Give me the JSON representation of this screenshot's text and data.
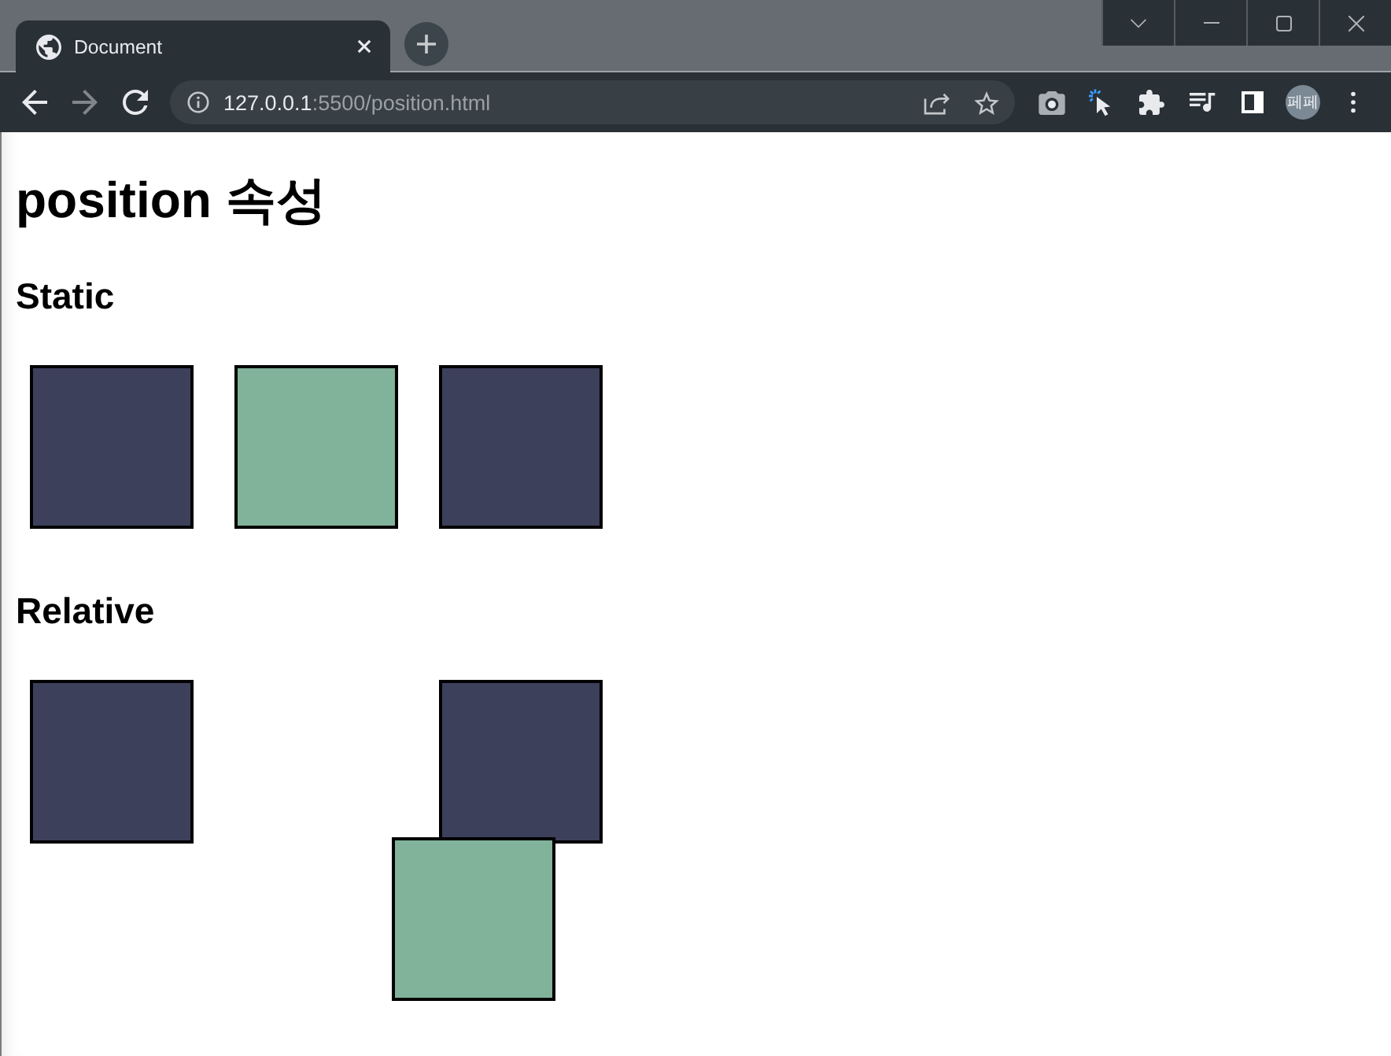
{
  "tabs": [
    {
      "title": "Document",
      "selected": true
    }
  ],
  "nav_buttons": [
    {
      "kind": "back",
      "disabled": false
    },
    {
      "kind": "forward",
      "disabled": true
    },
    {
      "kind": "reload",
      "disabled": false
    }
  ],
  "address_bar": {
    "host": "127.0.0.1",
    "path": ":5500/position.html"
  },
  "profile": {
    "initials": "페페"
  },
  "page": {
    "heading": "position 속성",
    "sections": [
      {
        "title": "Static",
        "boxes": [
          {
            "kind": "inline",
            "color": "#3d405b"
          },
          {
            "kind": "inline",
            "color": "#81b29a"
          },
          {
            "kind": "inline",
            "color": "#3d405b"
          }
        ]
      },
      {
        "title": "Relative",
        "boxes": [
          {
            "kind": "inline",
            "color": "#3d405b"
          },
          {
            "kind": "offset",
            "color": "#81b29a"
          },
          {
            "kind": "inline",
            "color": "#3d405b"
          }
        ]
      }
    ]
  }
}
